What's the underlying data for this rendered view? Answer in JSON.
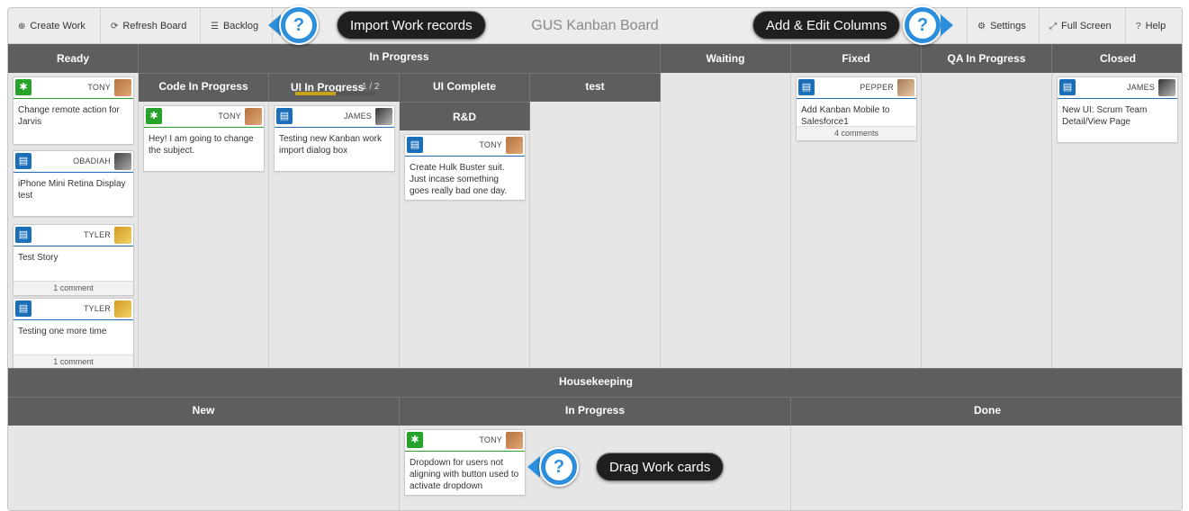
{
  "app": {
    "title": "GUS Kanban Board"
  },
  "toolbar": {
    "create_work": "Create Work",
    "refresh_board": "Refresh Board",
    "backlog": "Backlog",
    "settings": "Settings",
    "full_screen": "Full Screen",
    "help": "Help"
  },
  "columns": {
    "ready": "Ready",
    "in_progress": "In Progress",
    "code_in_progress": "Code In Progress",
    "ui_in_progress": "UI In Progress",
    "ui_in_progress_count": "1 / 2",
    "ui_in_progress_fraction": 0.5,
    "ui_complete": "UI Complete",
    "rnd": "R&D",
    "test": "test",
    "waiting": "Waiting",
    "fixed": "Fixed",
    "qa_in_progress": "QA In Progress",
    "closed": "Closed"
  },
  "housekeeping": {
    "title": "Housekeeping",
    "new": "New",
    "in_progress": "In Progress",
    "done": "Done"
  },
  "cards": {
    "c1": {
      "type": "bug",
      "owner": "TONY",
      "text": "Change remote action for Jarvis"
    },
    "c2": {
      "type": "story",
      "owner": "OBADIAH",
      "text": "iPhone Mini Retina Display test"
    },
    "c3": {
      "type": "story",
      "owner": "TYLER",
      "text": "Test Story",
      "comments": "1 comment"
    },
    "c4": {
      "type": "story",
      "owner": "TYLER",
      "text": "Testing one more time",
      "comments": "1 comment"
    },
    "c5": {
      "type": "bug",
      "owner": "TONY",
      "text": "Hey! I am going to change the subject."
    },
    "c6": {
      "type": "story",
      "owner": "JAMES",
      "text": "Testing new Kanban work import dialog box"
    },
    "c7": {
      "type": "story",
      "owner": "TONY",
      "text": "Create Hulk Buster suit. Just incase something goes really bad one day."
    },
    "c8": {
      "type": "story",
      "owner": "PEPPER",
      "text": "Add Kanban Mobile to Salesforce1",
      "comments": "4 comments"
    },
    "c9": {
      "type": "story",
      "owner": "JAMES",
      "text": "New UI: Scrum Team Detail/View Page"
    },
    "c10": {
      "type": "bug",
      "owner": "TONY",
      "text": "Dropdown for users not aligning with button used to activate dropdown"
    }
  },
  "callouts": {
    "import": "Import Work records",
    "columns": "Add & Edit Columns",
    "drag": "Drag Work cards",
    "symbol": "?"
  },
  "icons": {
    "create": "plus-circle-icon",
    "refresh": "refresh-icon",
    "backlog": "list-icon",
    "settings": "gear-icon",
    "fullscreen": "expand-icon",
    "help": "question-circle-icon",
    "bug": "bug-icon",
    "story": "book-icon"
  },
  "colors": {
    "header": "#5e5e5e",
    "bug": "#27a32b",
    "story": "#1b6fb8",
    "progress": "#c8a21a",
    "callout": "#2d8fdb"
  }
}
